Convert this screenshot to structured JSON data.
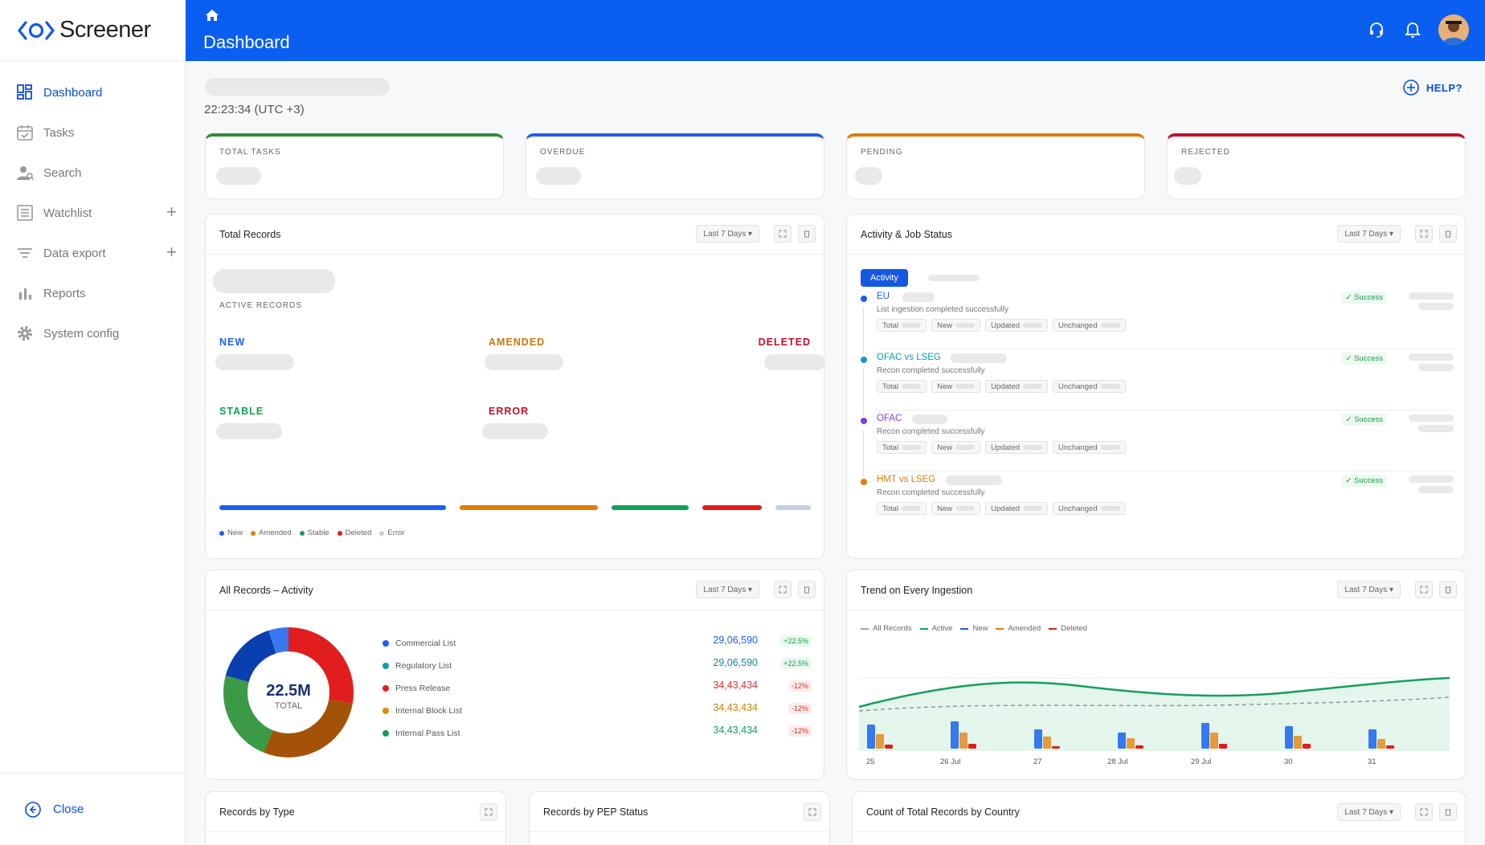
{
  "app": {
    "name": "Screener"
  },
  "sidebar": {
    "items": [
      {
        "label": "Dashboard",
        "icon": "dashboard-icon",
        "active": true
      },
      {
        "label": "Tasks",
        "icon": "calendar-icon"
      },
      {
        "label": "Search",
        "icon": "user-search-icon"
      },
      {
        "label": "Watchlist",
        "icon": "list-icon"
      },
      {
        "label": "Data export",
        "icon": "filter-icon"
      },
      {
        "label": "Reports",
        "icon": "bar-chart-icon"
      },
      {
        "label": "System config",
        "icon": "gear-icon"
      }
    ],
    "close_label": "Close"
  },
  "header": {
    "title": "Dashboard"
  },
  "main": {
    "time": "22:23:34 (UTC +3)",
    "help_label": "HELP?",
    "kpis": [
      {
        "label": "TOTAL TASKS",
        "color": "#2e8b3e"
      },
      {
        "label": "OVERDUE",
        "color": "#1e5ef0"
      },
      {
        "label": "PENDING",
        "color": "#e07b0a"
      },
      {
        "label": "REJECTED",
        "color": "#c0102a"
      }
    ],
    "range_label": "Last 7 Days ▾",
    "total_records": {
      "title": "Total Records",
      "active_label": "ACTIVE RECORDS",
      "categories": {
        "new": "NEW",
        "amended": "AMENDED",
        "deleted": "DELETED",
        "stable": "STABLE",
        "error": "ERROR"
      },
      "legend": [
        "New",
        "Amended",
        "Stable",
        "Deleted",
        "Error"
      ]
    },
    "activity": {
      "title": "Activity & Job Status",
      "tab_label": "Activity",
      "chip_labels": [
        "Total",
        "New",
        "Updated",
        "Unchanged"
      ],
      "success_label": "✓ Success",
      "jobs": [
        {
          "name": "EU",
          "message": "List ingestion completed successfully",
          "color": "#1e5ef0"
        },
        {
          "name": "OFAC vs LSEG",
          "message": "Recon completed successfully",
          "color": "#0d9bb0"
        },
        {
          "name": "OFAC",
          "message": "Recon completed successfully",
          "color": "#7b3fe0"
        },
        {
          "name": "HMT vs LSEG",
          "message": "Recon completed successfully",
          "color": "#e07b0a"
        }
      ]
    },
    "all_records": {
      "title": "All Records – Activity",
      "total_value": "22.5M",
      "total_label": "TOTAL",
      "lists": [
        {
          "label": "Commercial List",
          "value": "29,06,590",
          "change": "+22.5%",
          "color": "#1e5ef0",
          "val_color": "#1e5ef0",
          "dir": "up"
        },
        {
          "label": "Regulatory List",
          "value": "29,06,590",
          "change": "+22.5%",
          "color": "#0d9bb0",
          "val_color": "#0d8a9e",
          "dir": "up"
        },
        {
          "label": "Press Release",
          "value": "34,43,434",
          "change": "-12%",
          "color": "#e11d1d",
          "val_color": "#d32f2f",
          "dir": "down"
        },
        {
          "label": "Internal Block List",
          "value": "34,43,434",
          "change": "-12%",
          "color": "#e08a0a",
          "val_color": "#c98208",
          "dir": "down"
        },
        {
          "label": "Internal Pass List",
          "value": "34,43,434",
          "change": "-12%",
          "color": "#12a05a",
          "val_color": "#12a05a",
          "dir": "down"
        }
      ]
    },
    "trend": {
      "title": "Trend on Every Ingestion",
      "legend": [
        {
          "label": "All Records",
          "color": "#9aa3ad"
        },
        {
          "label": "Active",
          "color": "#12a05a"
        },
        {
          "label": "New",
          "color": "#1e5ef0"
        },
        {
          "label": "Amended",
          "color": "#e07b0a"
        },
        {
          "label": "Deleted",
          "color": "#e11d1d"
        }
      ],
      "x_labels": [
        "25",
        "26 Jul",
        "27",
        "28 Jul",
        "29 Jul",
        "30",
        "31"
      ]
    },
    "bottom": {
      "by_type": "Records by Type",
      "by_pep": "Records by PEP Status",
      "by_country": "Count of Total Records by Country"
    }
  }
}
